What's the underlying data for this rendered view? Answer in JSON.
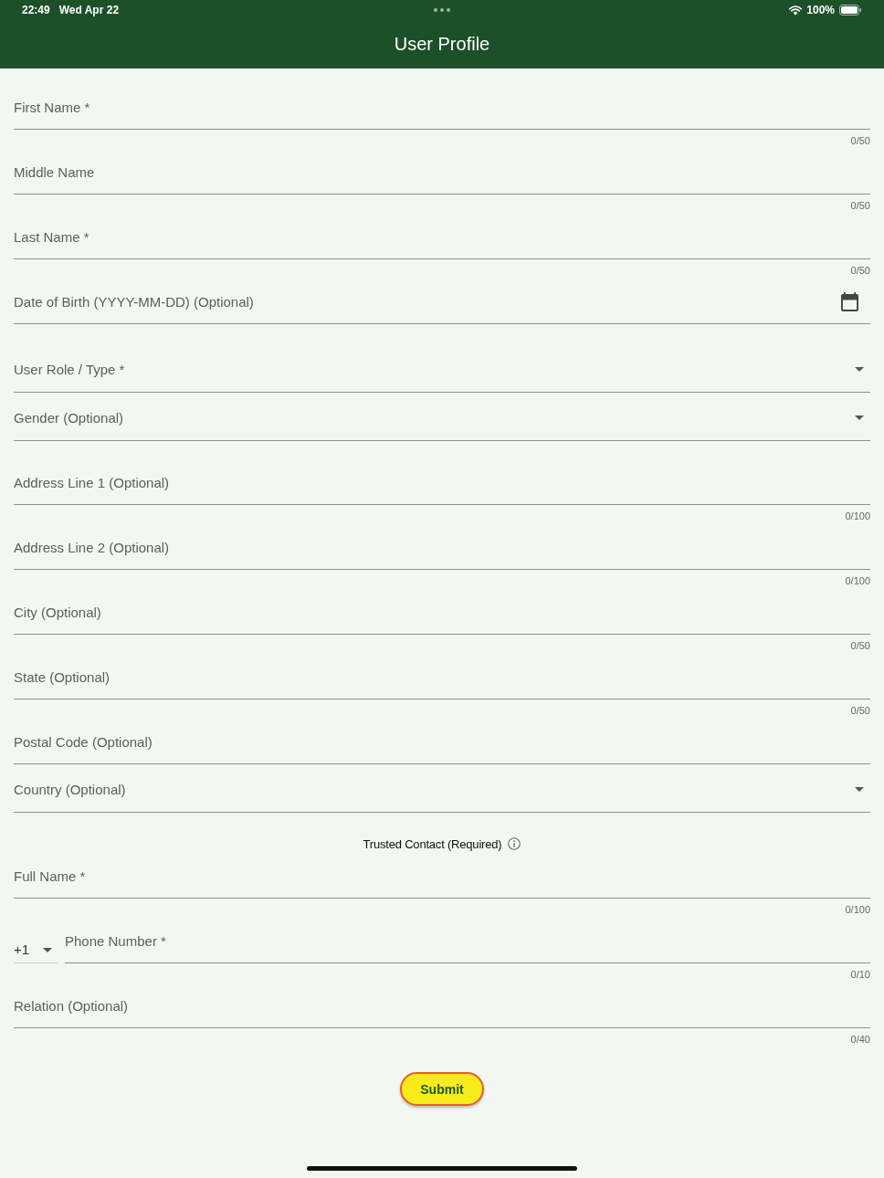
{
  "status_bar": {
    "time": "22:49",
    "date": "Wed Apr 22",
    "battery": "100%"
  },
  "app_bar": {
    "title": "User Profile"
  },
  "profile_fields": [
    {
      "kind": "text",
      "placeholder": "First Name *",
      "counter": "0/50"
    },
    {
      "kind": "text",
      "placeholder": "Middle Name",
      "counter": "0/50"
    },
    {
      "kind": "text",
      "placeholder": "Last Name *",
      "counter": "0/50"
    },
    {
      "kind": "date",
      "placeholder": "Date of Birth (YYYY-MM-DD) (Optional)"
    },
    {
      "kind": "dropdown",
      "placeholder": "User Role / Type *"
    },
    {
      "kind": "dropdown",
      "placeholder": "Gender (Optional)"
    },
    {
      "kind": "text",
      "placeholder": "Address Line 1 (Optional)",
      "counter": "0/100"
    },
    {
      "kind": "text",
      "placeholder": "Address Line 2 (Optional)",
      "counter": "0/100"
    },
    {
      "kind": "text",
      "placeholder": "City (Optional)",
      "counter": "0/50"
    },
    {
      "kind": "text",
      "placeholder": "State (Optional)",
      "counter": "0/50"
    },
    {
      "kind": "text",
      "placeholder": "Postal Code (Optional)"
    },
    {
      "kind": "dropdown",
      "placeholder": "Country (Optional)"
    }
  ],
  "trusted_contact": {
    "title": "Trusted Contact (Required)",
    "fields": [
      {
        "kind": "text",
        "placeholder": "Full Name *",
        "counter": "0/100"
      },
      {
        "kind": "phone",
        "country_code": "+1",
        "placeholder": "Phone Number *",
        "counter": "0/10"
      },
      {
        "kind": "text",
        "placeholder": "Relation (Optional)",
        "counter": "0/40"
      }
    ]
  },
  "submit_button": {
    "label": "Submit"
  }
}
